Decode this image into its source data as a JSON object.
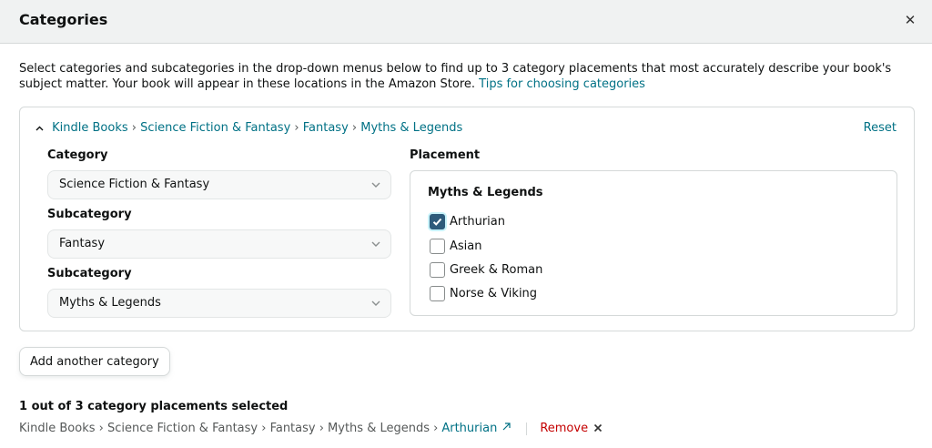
{
  "dialog": {
    "title": "Categories",
    "close_glyph": "✕"
  },
  "intro": {
    "text": "Select categories and subcategories in the drop-down menus below to find up to 3 category placements that most accurately describe your book's subject matter. Your book will appear in these locations in the Amazon Store.",
    "tips_link": "Tips for choosing categories"
  },
  "category_card": {
    "breadcrumb": [
      "Kindle Books",
      "Science Fiction & Fantasy",
      "Fantasy",
      "Myths & Legends"
    ],
    "breadcrumb_separator": "›",
    "reset_label": "Reset",
    "category": {
      "label": "Category",
      "value": "Science Fiction & Fantasy"
    },
    "subcategory_1": {
      "label": "Subcategory",
      "value": "Fantasy"
    },
    "subcategory_2": {
      "label": "Subcategory",
      "value": "Myths & Legends"
    },
    "placement": {
      "label": "Placement",
      "group_title": "Myths & Legends",
      "options": [
        {
          "label": "Arthurian",
          "checked": true
        },
        {
          "label": "Asian",
          "checked": false
        },
        {
          "label": "Greek & Roman",
          "checked": false
        },
        {
          "label": "Norse & Viking",
          "checked": false
        }
      ]
    }
  },
  "add_category_label": "Add another category",
  "summary": {
    "count_text": "1 out of 3 category placements selected",
    "selected_path": "Kindle Books › Science Fiction & Fantasy › Fantasy › Myths & Legends ›",
    "selected_leaf": "Arthurian",
    "remove_label": "Remove"
  },
  "colors": {
    "link": "#007185",
    "remove": "#c40000",
    "checkbox_checked": "#2d5b7b",
    "header_bg": "#f0f2f2"
  },
  "icons": {
    "close": "close-icon",
    "caret": "caret-up-icon",
    "chevron": "chevron-down-icon",
    "check": "checkmark-icon",
    "external": "external-link-icon",
    "remove": "remove-x-icon"
  }
}
